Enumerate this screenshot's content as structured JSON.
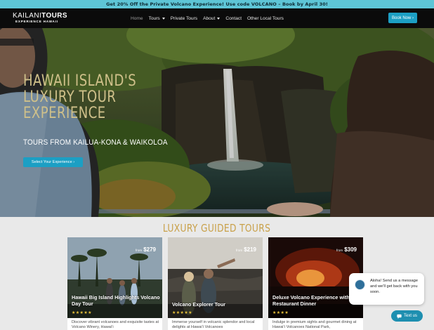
{
  "promo": {
    "text": "Get 20% Off the Private Volcano Experience! Use code VOLCANO – Book by April 30!"
  },
  "header": {
    "logo_line1_thin": "KAILANI",
    "logo_line1_bold": "TOURS",
    "logo_line2": "EXPERIENCE HAWAII",
    "nav": [
      {
        "label": "Home",
        "active": true,
        "dropdown": false
      },
      {
        "label": "Tours",
        "active": false,
        "dropdown": true
      },
      {
        "label": "Private Tours",
        "active": false,
        "dropdown": false
      },
      {
        "label": "About",
        "active": false,
        "dropdown": true
      },
      {
        "label": "Contact",
        "active": false,
        "dropdown": false
      },
      {
        "label": "Other Local Tours",
        "active": false,
        "dropdown": false
      }
    ],
    "book_button": "Book Now ›"
  },
  "hero": {
    "title": "Hawaii Island's Luxury Tour Experience",
    "subtitle": "TOURS FROM KAILUA-KONA & WAIKOLOA",
    "button": "Select Your Experience ›"
  },
  "section": {
    "title": "LUXURY GUIDED TOURS"
  },
  "cards": [
    {
      "from": "from",
      "price": "$279",
      "name": "Hawaii Big Island Highlights Volcano Day Tour",
      "stars": "★★★★★",
      "description": "Discover vibrant volcanoes and exquisite tastes at Volcano Winery, Hawaiʻi"
    },
    {
      "from": "from",
      "price": "$219",
      "name": "Volcano Explorer Tour",
      "stars": "★★★★★",
      "description": "Immerse yourself in volcanic splendor and local delights at Hawaiʻi Volcanoes"
    },
    {
      "from": "from",
      "price": "$309",
      "name": "Deluxe Volcano Experience with Restaurant Dinner",
      "stars": "★★★★",
      "description": "Indulge in premium sights and gourmet dining at Hawaiʻi Volcanoes National Park,"
    }
  ],
  "chat": {
    "message": "Aloha! Send us a message and we'll get back with you soon.",
    "button": "Text us"
  },
  "colors": {
    "accent": "#1c9fc4",
    "promo": "#5ec5d6",
    "gold": "#c9a14a",
    "stars": "#e9c23b"
  }
}
